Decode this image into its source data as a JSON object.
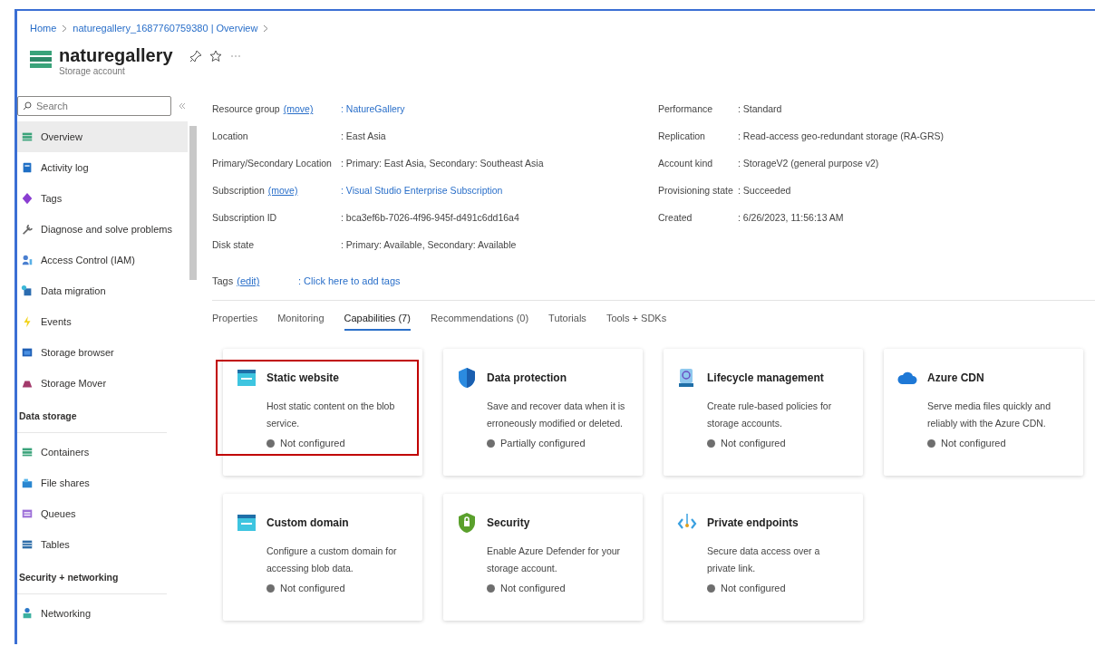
{
  "breadcrumb": [
    "Home",
    "naturegallery_1687760759380 | Overview"
  ],
  "header": {
    "title": "naturegallery",
    "subtitle": "Storage account"
  },
  "sidebar": {
    "search": {
      "placeholder": "Search"
    },
    "items": [
      {
        "kind": "item",
        "label": "Overview",
        "selected": true
      },
      {
        "kind": "item",
        "label": "Activity log",
        "selected": false
      },
      {
        "kind": "item",
        "label": "Tags",
        "selected": false
      },
      {
        "kind": "item",
        "label": "Diagnose and solve problems",
        "selected": false
      },
      {
        "kind": "item",
        "label": "Access Control (IAM)",
        "selected": false
      },
      {
        "kind": "item",
        "label": "Data migration",
        "selected": false
      },
      {
        "kind": "item",
        "label": "Events",
        "selected": false
      },
      {
        "kind": "item",
        "label": "Storage browser",
        "selected": false
      },
      {
        "kind": "item",
        "label": "Storage Mover",
        "selected": false
      },
      {
        "kind": "header",
        "label": "Data storage"
      },
      {
        "kind": "item",
        "label": "Containers",
        "selected": false
      },
      {
        "kind": "item",
        "label": "File shares",
        "selected": false
      },
      {
        "kind": "item",
        "label": "Queues",
        "selected": false
      },
      {
        "kind": "item",
        "label": "Tables",
        "selected": false
      },
      {
        "kind": "header",
        "label": "Security + networking"
      },
      {
        "kind": "item",
        "label": "Networking",
        "selected": false
      }
    ]
  },
  "essentials": {
    "left": [
      {
        "label": "Resource group",
        "action": "(move)",
        "value": ": NatureGallery",
        "value_link": true
      },
      {
        "label": "Location",
        "value": ": East Asia",
        "value_link": false
      },
      {
        "label": "Primary/Secondary Location",
        "value": ": Primary: East Asia, Secondary: Southeast Asia",
        "value_link": false
      },
      {
        "label": "Subscription",
        "action": "(move)",
        "value": ": Visual Studio Enterprise Subscription",
        "value_link": true
      },
      {
        "label": "Subscription ID",
        "value": ": bca3ef6b-7026-4f96-945f-d491c6dd16a4",
        "value_link": false
      },
      {
        "label": "Disk state",
        "value": ": Primary: Available, Secondary: Available",
        "value_link": false
      }
    ],
    "right": [
      {
        "label": "Performance",
        "value": ": Standard",
        "value_link": false
      },
      {
        "label": "Replication",
        "value": ": Read-access geo-redundant storage (RA-GRS)",
        "value_link": false
      },
      {
        "label": "Account kind",
        "value": ": StorageV2 (general purpose v2)",
        "value_link": false
      },
      {
        "label": "Provisioning state",
        "value": ": Succeeded",
        "value_link": false
      },
      {
        "label": "Created",
        "value": ": 6/26/2023, 11:56:13 AM",
        "value_link": false
      }
    ],
    "tags": {
      "label": "Tags",
      "action": "(edit)",
      "value": ": Click here to add tags"
    }
  },
  "tabs": [
    {
      "label": "Properties",
      "selected": false
    },
    {
      "label": "Monitoring",
      "selected": false
    },
    {
      "label": "Capabilities (7)",
      "selected": true
    },
    {
      "label": "Recommendations (0)",
      "selected": false
    },
    {
      "label": "Tutorials",
      "selected": false
    },
    {
      "label": "Tools + SDKs",
      "selected": false
    }
  ],
  "cards": [
    {
      "title": "Static website",
      "description": "Host static content on the blob service.",
      "status": "Not configured",
      "highlighted": true
    },
    {
      "title": "Data protection",
      "description": "Save and recover data when it is erroneously modified or deleted.",
      "status": "Partially configured",
      "highlighted": false
    },
    {
      "title": "Lifecycle management",
      "description": "Create rule-based policies for storage accounts.",
      "status": "Not configured",
      "highlighted": false
    },
    {
      "title": "Azure CDN",
      "description": "Serve media files quickly and reliably with the Azure CDN.",
      "status": "Not configured",
      "highlighted": false
    },
    {
      "title": "Custom domain",
      "description": "Configure a custom domain for accessing blob data.",
      "status": "Not configured",
      "highlighted": false
    },
    {
      "title": "Security",
      "description": "Enable Azure Defender for your storage account.",
      "status": "Not configured",
      "highlighted": false
    },
    {
      "title": "Private endpoints",
      "description": "Secure data access over a private link.",
      "status": "Not configured",
      "highlighted": false
    }
  ]
}
